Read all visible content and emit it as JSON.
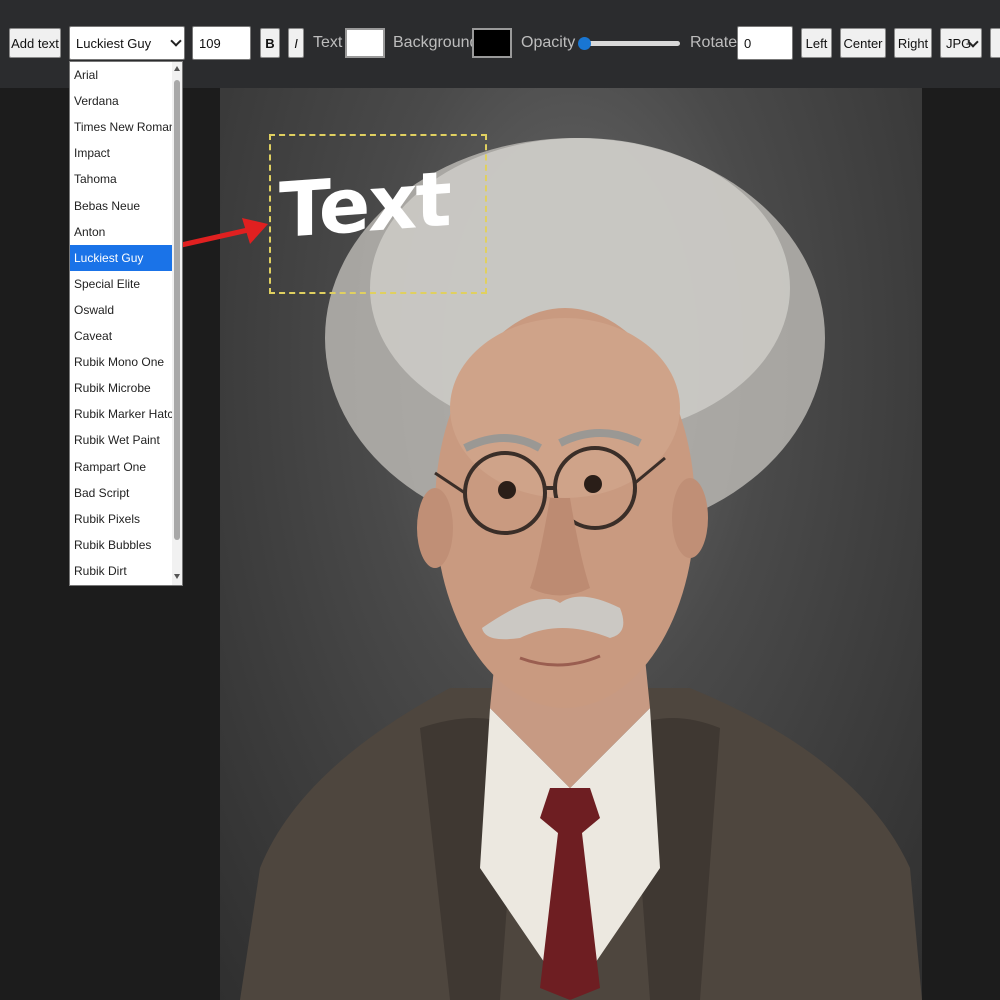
{
  "toolbar": {
    "add_text_label": "Add text",
    "font_select_value": "Luckiest Guy",
    "font_size_value": "109",
    "bold_label": "B",
    "italic_label": "I",
    "text_color_label": "Text",
    "text_color": "#ffffff",
    "background_label": "Background",
    "background_color": "#000000",
    "opacity_label": "Opacity",
    "opacity_value": 0.03,
    "rotate_label": "Rotate",
    "rotate_value": "0",
    "align_left_label": "Left",
    "align_center_label": "Center",
    "align_right_label": "Right",
    "format_value": "JPG"
  },
  "font_dropdown": {
    "selected": "Luckiest Guy",
    "options": [
      "Arial",
      "Verdana",
      "Times New Roman",
      "Impact",
      "Tahoma",
      "Bebas Neue",
      "Anton",
      "Luckiest Guy",
      "Special Elite",
      "Oswald",
      "Caveat",
      "Rubik Mono One",
      "Rubik Microbe",
      "Rubik Marker Hatch",
      "Rubik Wet Paint",
      "Rampart One",
      "Bad Script",
      "Rubik Pixels",
      "Rubik Bubbles",
      "Rubik Dirt"
    ]
  },
  "canvas": {
    "overlay_text": "Text",
    "annotation_arrow_color": "#e02020"
  }
}
